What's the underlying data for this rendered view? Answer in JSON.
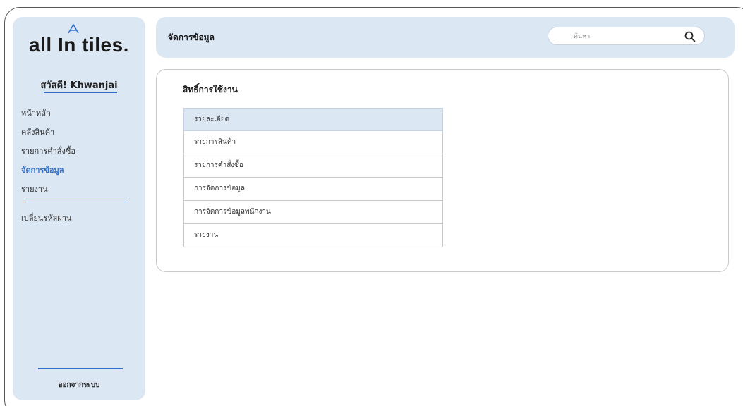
{
  "brand": {
    "logo_text": "all In tiles."
  },
  "sidebar": {
    "greeting": "สวัสดี! Khwanjai",
    "items": [
      {
        "label": "หน้าหลัก",
        "active": false
      },
      {
        "label": "คลังสินค้า",
        "active": false
      },
      {
        "label": "รายการคำสั่งซื้อ",
        "active": false
      },
      {
        "label": "จัดการข้อมูล",
        "active": true
      },
      {
        "label": "รายงาน",
        "active": false
      }
    ],
    "change_password": "เปลี่ยนรหัสผ่าน",
    "logout": "ออกจากระบบ"
  },
  "header": {
    "title": "จัดการข้อมูล",
    "search_placeholder": "ค้นหา",
    "search_icon": "magnifier"
  },
  "main": {
    "section_title": "สิทธิ์การใช้งาน",
    "permissions": [
      {
        "label": "รายละเอียด",
        "selected": true
      },
      {
        "label": "รายการสินค้า",
        "selected": false
      },
      {
        "label": "รายการคำสั่งซื้อ",
        "selected": false
      },
      {
        "label": "การจัดการข้อมูล",
        "selected": false
      },
      {
        "label": "การจัดการข้อมูลพนักงาน",
        "selected": false
      },
      {
        "label": "รายงาน",
        "selected": false
      }
    ]
  },
  "colors": {
    "accent": "#2f6fc9",
    "panel": "#dce7f4"
  }
}
